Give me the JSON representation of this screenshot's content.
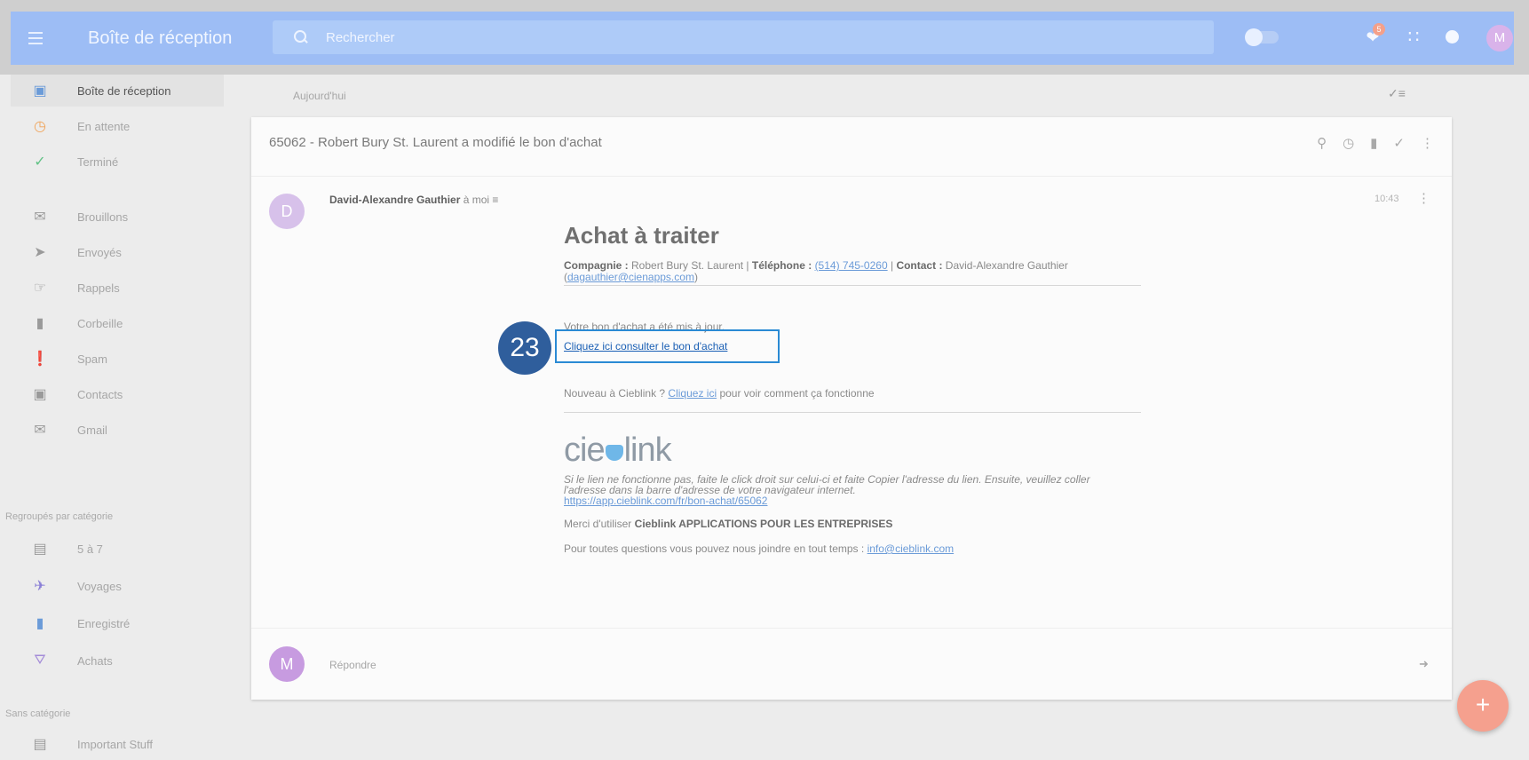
{
  "header": {
    "app_title": "Boîte de réception",
    "search_placeholder": "Rechercher",
    "notification_count": "5",
    "avatar_initial": "M"
  },
  "sidebar": {
    "items": [
      {
        "label": "Boîte de réception",
        "icon": "inbox-icon"
      },
      {
        "label": "En attente",
        "icon": "clock-icon"
      },
      {
        "label": "Terminé",
        "icon": "check-icon"
      },
      {
        "label": "Brouillons",
        "icon": "drafts-icon"
      },
      {
        "label": "Envoyés",
        "icon": "send-icon"
      },
      {
        "label": "Rappels",
        "icon": "reminder-icon"
      },
      {
        "label": "Corbeille",
        "icon": "trash-icon"
      },
      {
        "label": "Spam",
        "icon": "spam-icon"
      },
      {
        "label": "Contacts",
        "icon": "contacts-icon"
      },
      {
        "label": "Gmail",
        "icon": "gmail-icon"
      }
    ],
    "group_heading": "Regroupés par catégorie",
    "group_items": [
      {
        "label": "5 à 7",
        "icon": "bundle-icon"
      },
      {
        "label": "Voyages",
        "icon": "plane-icon"
      },
      {
        "label": "Enregistré",
        "icon": "bookmark-icon"
      },
      {
        "label": "Achats",
        "icon": "cart-icon"
      }
    ],
    "uncategorized_heading": "Sans catégorie",
    "uncategorized_items": [
      {
        "label": "Important Stuff",
        "icon": "bundle-icon"
      }
    ]
  },
  "main": {
    "date_label": "Aujourd'hui",
    "subject": "65062 - Robert Bury St. Laurent a modifié le bon d'achat",
    "sender_initial": "D",
    "sender_name": "David-Alexandre Gauthier",
    "recipient": "à moi",
    "time": "10:43",
    "reply_avatar_initial": "M",
    "reply_label": "Répondre"
  },
  "email": {
    "heading": "Achat à traiter",
    "company_key": "Compagnie :",
    "company_value": "Robert Bury St. Laurent |",
    "phone_key": "Téléphone :",
    "phone_value": "(514) 745-0260",
    "contact_sep": "|",
    "contact_key": "Contact :",
    "contact_value": "David-Alexandre Gauthier",
    "contact_email": "dagauthier@cienapps.com",
    "updated_text": "Votre bon d'achat a été mis à jour.",
    "cta_link": "Cliquez ici consulter le bon d'achat",
    "new_prefix": "Nouveau à Cieblink ?",
    "new_link": "Cliquez ici",
    "new_suffix": "pour voir comment ça fonctionne",
    "logo_left": "cie",
    "logo_right": "link",
    "note_text": "Si le lien ne fonctionne pas, faite le click droit sur celui-ci et faite Copier l'adresse du lien. Ensuite, veuillez coller l'adresse dans la barre d'adresse de votre navigateur internet.",
    "note_url": "https://app.cieblink.com/fr/bon-achat/65062",
    "thanks_prefix": "Merci d'utiliser",
    "thanks_brand": "Cieblink APPLICATIONS POUR LES ENTREPRISES",
    "questions_text": "Pour toutes questions vous pouvez nous joindre en tout temps :",
    "questions_email": "info@cieblink.com"
  },
  "annotation": {
    "step_number": "23",
    "color": "#2f5e9c",
    "highlight_color": "#2a8ad4"
  },
  "fab": {
    "icon": "plus-icon",
    "label": "+"
  }
}
